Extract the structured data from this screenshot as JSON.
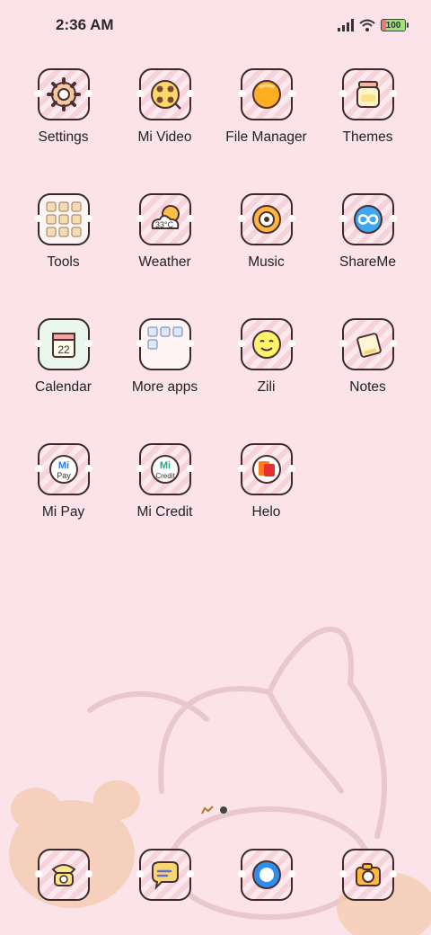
{
  "status_bar": {
    "time": "2:36 AM",
    "battery_level": "100",
    "icons": [
      "signal-icon",
      "wifi-icon",
      "battery-icon"
    ]
  },
  "apps": [
    {
      "label": "Settings",
      "icon": "gear-icon"
    },
    {
      "label": "Mi Video",
      "icon": "film-reel-icon"
    },
    {
      "label": "File Manager",
      "icon": "folder-icon"
    },
    {
      "label": "Themes",
      "icon": "jar-icon"
    },
    {
      "label": "Tools",
      "icon": "tools-folder-icon"
    },
    {
      "label": "Weather",
      "icon": "weather-cloud-icon",
      "temp": "33°C"
    },
    {
      "label": "Music",
      "icon": "music-disc-icon"
    },
    {
      "label": "ShareMe",
      "icon": "infinity-icon"
    },
    {
      "label": "Calendar",
      "icon": "calendar-icon",
      "day": "22"
    },
    {
      "label": "More apps",
      "icon": "more-apps-folder-icon"
    },
    {
      "label": "Zili",
      "icon": "zili-face-icon"
    },
    {
      "label": "Notes",
      "icon": "notepad-icon"
    },
    {
      "label": "Mi Pay",
      "icon": "mi-pay-icon",
      "badge": "Pay",
      "mi": "Mi"
    },
    {
      "label": "Mi Credit",
      "icon": "mi-credit-icon",
      "badge": "Credit",
      "mi": "Mi"
    },
    {
      "label": "Helo",
      "icon": "helo-icon"
    }
  ],
  "dock": [
    {
      "name": "phone",
      "icon": "telephone-icon"
    },
    {
      "name": "messages",
      "icon": "message-bubble-icon"
    },
    {
      "name": "browser",
      "icon": "browser-icon"
    },
    {
      "name": "camera",
      "icon": "camera-icon"
    }
  ],
  "colors": {
    "background": "#fbe3e9",
    "tile_stripe": "#f6d3db",
    "outline": "#3a2a2a"
  }
}
